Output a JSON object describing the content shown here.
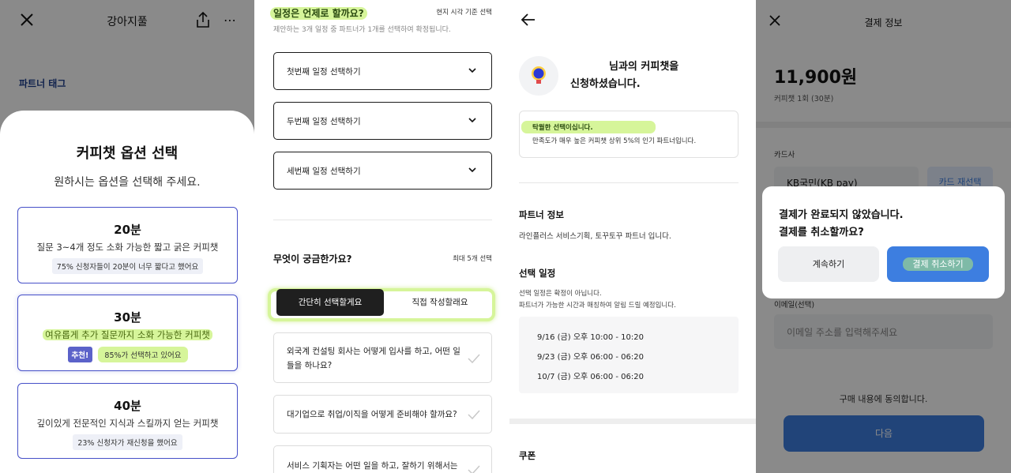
{
  "panel1": {
    "header": {
      "title": "강아지풀"
    },
    "section_label": "파트너 태그",
    "sheet": {
      "title": "커피챗 옵션 선택",
      "subtitle": "원하시는 옵션을 선택해 주세요.",
      "options": [
        {
          "title": "20분",
          "desc": "질문 3~4개 정도 소화 가능한 짧고 굵은 커피챗",
          "chip": "75% 신청자들이 20분이 너무 짧다고 했어요"
        },
        {
          "title": "30분",
          "desc": "여유롭게 추가 질문까지 소화 가능한 커피챗",
          "badge": "추천!",
          "chip": "85%가 선택하고 있어요"
        },
        {
          "title": "40분",
          "desc": "깊이있게 전문적인 지식과 스킬까지 얻는 커피챗",
          "chip": "23% 신청자가 재신청을 했어요"
        }
      ]
    }
  },
  "panel2": {
    "schedule": {
      "question": "일정은 언제로 할까요?",
      "note": "현지 시각 기준 선택",
      "desc": "제안하는 3개 일정 중 파트너가 1개를 선택하여 확정됩니다.",
      "selects": [
        "첫번째 일정 선택하기",
        "두번째 일정 선택하기",
        "세번째 일정 선택하기"
      ]
    },
    "topic": {
      "question": "무엇이 궁금한가요?",
      "note": "최대 5개 선택",
      "tabs": [
        "간단히 선택할게요",
        "직접 작성할래요"
      ],
      "items": [
        [
          "외국계 컨설팅 회사는 어떻게 입사를 하고, 어떤 일",
          "들을 하나요?"
        ],
        [
          "대기업으로 취업/이직을 어떻게 준비해야 할까요?"
        ],
        [
          "서비스 기획자는 어떤 일을 하고, 잘하기 위해서는"
        ]
      ]
    }
  },
  "panel3": {
    "title_line1": "님과의 커피챗을",
    "title_line2": "신청하셨습니다.",
    "notice": {
      "highlight": "탁월한 선택이십니다.",
      "text": "만족도가 매우 높은 커피챗 상위 5%의 인기 파트너입니다."
    },
    "partner": {
      "label": "파트너 정보",
      "text": "라인플러스 서비스기획, 토꾸토꾸 파트너 입니다."
    },
    "schedule": {
      "label": "선택 일정",
      "note1": "선택 일정은 확정이 아닙니다.",
      "note2": "파트너가 가능한 시간과 매칭하여 알림 드릴 예정입니다.",
      "slots": [
        "9/16 (금) 오후 10:00 - 10:20",
        "9/23 (금) 오후 06:00 - 06:20",
        "10/7 (금) 오후 06:00 - 06:20"
      ]
    },
    "coupon_label": "쿠폰"
  },
  "panel4": {
    "header": {
      "title": "결제 정보"
    },
    "price": "11,900원",
    "price_note": "커피챗 1회 (30분)",
    "card_label": "카드사",
    "card_value": "KB국민(KB pay)",
    "card_change": "카드 재선택",
    "email_label": "이메일(선택)",
    "email_placeholder": "이메일 주소를 입력해주세요",
    "agree_text": "구매 내용에 동의합니다.",
    "next_label": "다음",
    "dialog": {
      "line1": "결제가 완료되지 않았습니다.",
      "line2": "결제를 취소할까요?",
      "continue_label": "계속하기",
      "cancel_label": "결제 취소하기"
    }
  },
  "colors": {
    "primary": "#3d7ee0",
    "card_border": "#4650c8",
    "highlight": "#d6f59a",
    "badge": "#5b62c9",
    "dark_button": "#1f1f1f"
  }
}
